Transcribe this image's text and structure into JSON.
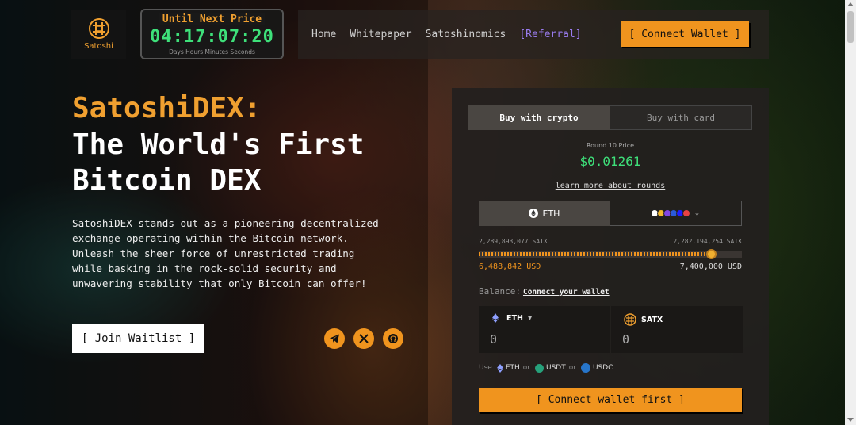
{
  "logo": {
    "text": "Satoshi"
  },
  "countdown": {
    "title": "Until Next Price",
    "digits": "04:17:07:20",
    "units": "Days Hours Minutes Seconds"
  },
  "nav": {
    "home": "Home",
    "whitepaper": "Whitepaper",
    "satoshinomics": "Satoshinomics",
    "referral": "[Referral]",
    "connect_wallet": "[ Connect Wallet ]"
  },
  "hero": {
    "title_accent": "SatoshiDEX:",
    "title_line1": "The World's First",
    "title_line2": "Bitcoin DEX",
    "description": "SatoshiDEX stands out as a pioneering decentralized exchange operating within the Bitcoin network. Unleash the sheer force of unrestricted trading while basking in the rock-solid security and unwavering stability that only Bitcoin can offer!",
    "join_waitlist": "[ Join Waitlist ]"
  },
  "social": [
    "telegram-icon",
    "x-icon",
    "github-icon"
  ],
  "widget": {
    "tab_crypto": "Buy with crypto",
    "tab_card": "Buy with card",
    "round_label": "Round 10 Price",
    "price": "$0.01261",
    "learn_more": "learn more about rounds",
    "currency_selected": "ETH",
    "sold_satx": "2,289,893,077 SATX",
    "total_satx": "2,282,194,254 SATX",
    "raised_usd": "6,488,842 USD",
    "target_usd": "7,400,000 USD",
    "progress_fraction": 0.87,
    "balance_label": "Balance:",
    "connect_your_wallet": "Connect your wallet",
    "pay_token": "ETH",
    "pay_value": "0",
    "receive_token": "SATX",
    "receive_value": "0",
    "use_label": "Use",
    "use_eth": "ETH",
    "or1": "or",
    "use_usdt": "USDT",
    "or2": "or",
    "use_usdc": "USDC",
    "connect_first": "[ Connect wallet first ]"
  },
  "colors": {
    "accent": "#f0941e",
    "price_green": "#3ee07a",
    "referral": "#9a7cf0"
  }
}
